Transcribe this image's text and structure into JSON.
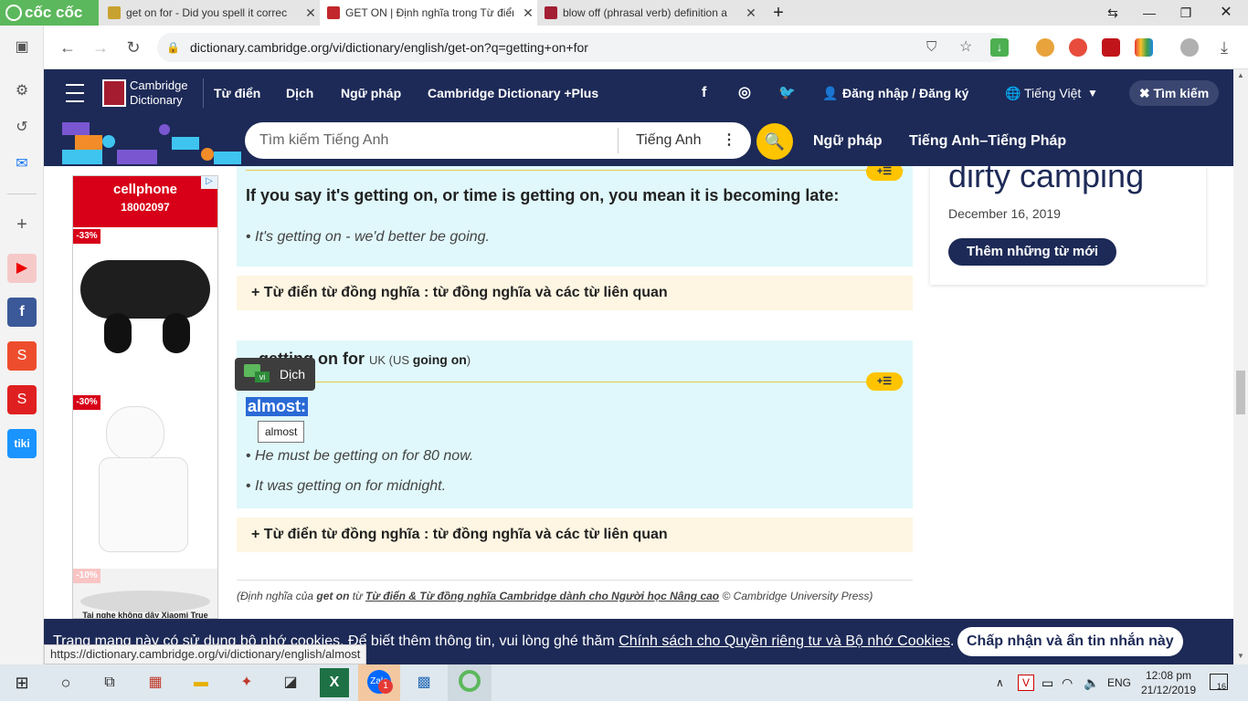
{
  "browser": {
    "brand": "cốc cốc",
    "tabs": [
      {
        "title": "get on for - Did you spell it correc",
        "active": false
      },
      {
        "title": "GET ON | Định nghĩa trong Từ điển",
        "active": true
      },
      {
        "title": "blow off (phrasal verb) definition a",
        "active": false
      }
    ],
    "url": "dictionary.cambridge.org/vi/dictionary/english/get-on?q=getting+on+for",
    "status_url": "https://dictionary.cambridge.org/vi/dictionary/english/almost"
  },
  "site": {
    "logo_line1": "Cambridge",
    "logo_line2": "Dictionary",
    "nav": [
      "Từ điển",
      "Dịch",
      "Ngữ pháp",
      "Cambridge Dictionary +Plus"
    ],
    "login": "Đăng nhập / Đăng ký",
    "language": "Tiếng Việt",
    "search_toggle": "Tìm kiếm",
    "search_placeholder": "Tìm kiếm Tiếng Anh",
    "search_lang": "Tiếng Anh",
    "sub_nav": [
      "Ngữ pháp",
      "Tiếng Anh–Tiếng Pháp"
    ]
  },
  "entry": {
    "def1": "If you say it's getting on, or time is getting on, you mean it is becoming late:",
    "ex1": "It's getting on - we'd better be going.",
    "thesaurus": "Từ điển từ đồng nghĩa : từ đồng nghĩa và các từ liên quan",
    "phrase": "getting on for",
    "region_uk": "UK",
    "region_us": "US",
    "phrase_alt": "going on",
    "def2": "almost:",
    "ex2a": "He must be getting on for 80 now.",
    "ex2b": "It was getting on for midnight.",
    "tooltip": "almost",
    "translate_btn": "Dịch",
    "translate_badge": "vi",
    "badge_symbol": "+☰",
    "source_prefix": "(Định nghĩa của",
    "source_word": "get on",
    "source_from": "từ",
    "source_link": "Từ điển & Từ đồng nghĩa Cambridge dành cho Người học Nâng cao",
    "source_suffix": "© Cambridge University Press)"
  },
  "ad": {
    "brand": "cellphone",
    "phone": "18002097",
    "d1": "-33%",
    "d2": "-30%",
    "d3": "-10%",
    "caption": "Tai nghe không dây Xiaomi True"
  },
  "right": {
    "title": "dirty camping",
    "date": "December 16, 2019",
    "more": "Thêm những từ mới"
  },
  "cookie": {
    "text": "Trang mạng này có sử dụng bộ nhớ cookies. Để biết thêm thông tin, vui lòng ghé thăm",
    "link": "Chính sách cho Quyền riêng tư và Bộ nhớ Cookies",
    "button": "Chấp nhận và ẩn tin nhắn này"
  },
  "taskbar": {
    "lang": "ENG",
    "time": "12:08 pm",
    "date": "21/12/2019",
    "notif": "16",
    "zalo_badge": "1"
  }
}
